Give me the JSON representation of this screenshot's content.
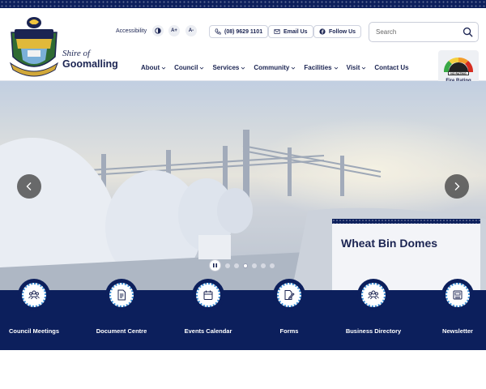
{
  "site": {
    "name_prefix": "Shire of",
    "name_main": "Goomalling"
  },
  "topbar": {
    "accessibility_label": "Accessibility",
    "contrast_icon": "contrast-icon",
    "font_increase": "A+",
    "font_decrease": "A-",
    "phone": "(08) 9629 1101",
    "email": "Email Us",
    "follow": "Follow Us"
  },
  "search": {
    "placeholder": "Search",
    "value": ""
  },
  "nav": {
    "items": [
      {
        "label": "About",
        "has_dropdown": true
      },
      {
        "label": "Council",
        "has_dropdown": true
      },
      {
        "label": "Services",
        "has_dropdown": true
      },
      {
        "label": "Community",
        "has_dropdown": true
      },
      {
        "label": "Facilities",
        "has_dropdown": true
      },
      {
        "label": "Visit",
        "has_dropdown": true
      },
      {
        "label": "Contact Us",
        "has_dropdown": false
      }
    ]
  },
  "fire_rating": {
    "label": "Fire Rating",
    "status": "NO RATING"
  },
  "hero": {
    "slide_title": "Wheat Bin Domes",
    "slide_count": 6,
    "active_slide": 3
  },
  "quick_links": [
    {
      "label": "Council Meetings",
      "icon": "people-icon"
    },
    {
      "label": "Document Centre",
      "icon": "document-icon"
    },
    {
      "label": "Events Calendar",
      "icon": "calendar-icon"
    },
    {
      "label": "Forms",
      "icon": "form-edit-icon"
    },
    {
      "label": "Business Directory",
      "icon": "people-icon"
    },
    {
      "label": "Newsletter",
      "icon": "newsletter-icon"
    }
  ],
  "colors": {
    "navy": "#0c1f5c",
    "accent_blue": "#3a8fd6",
    "text": "#1b2452"
  }
}
